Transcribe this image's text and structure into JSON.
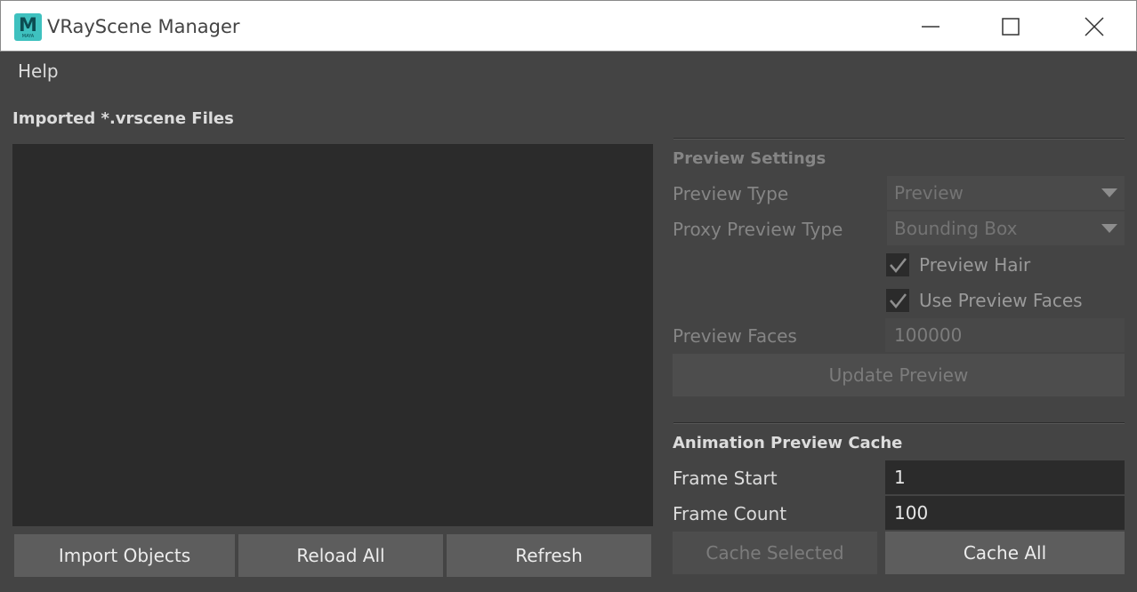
{
  "window": {
    "title": "VRayScene Manager",
    "icon": "maya-icon",
    "icon_letter": "M",
    "icon_caption": "MAYA"
  },
  "menu": {
    "items": [
      "Help"
    ]
  },
  "files": {
    "label": "Imported *.vrscene Files",
    "items": [],
    "buttons": {
      "import": "Import Objects",
      "reload": "Reload All",
      "refresh": "Refresh"
    }
  },
  "preview": {
    "title": "Preview Settings",
    "preview_type_label": "Preview Type",
    "preview_type_value": "Preview",
    "proxy_type_label": "Proxy Preview Type",
    "proxy_type_value": "Bounding Box",
    "preview_hair_label": "Preview Hair",
    "preview_hair_checked": true,
    "use_faces_label": "Use Preview Faces",
    "use_faces_checked": true,
    "faces_label": "Preview Faces",
    "faces_value": "100000",
    "update_button": "Update Preview"
  },
  "animation": {
    "title": "Animation Preview Cache",
    "frame_start_label": "Frame Start",
    "frame_start_value": "1",
    "frame_count_label": "Frame Count",
    "frame_count_value": "100",
    "cache_selected": "Cache Selected",
    "cache_all": "Cache All"
  },
  "colors": {
    "background": "#444444",
    "list_background": "#2b2b2b",
    "button": "#5d5d5d",
    "disabled_text": "#7c7c7c",
    "icon_teal": "#3ec1bf"
  }
}
